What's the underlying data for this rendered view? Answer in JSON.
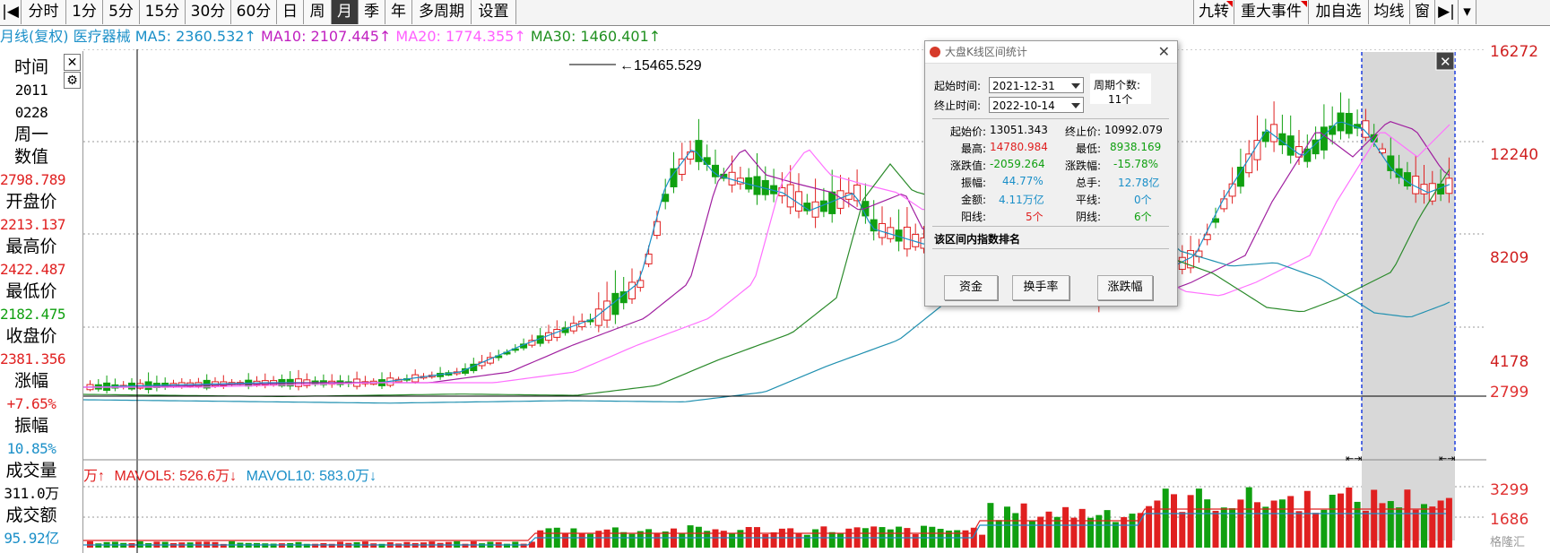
{
  "toolbar": {
    "left": [
      "分时",
      "1分",
      "5分",
      "15分",
      "30分",
      "60分",
      "日",
      "周",
      "月",
      "季",
      "年",
      "多周期",
      "设置"
    ],
    "active": "月",
    "right": [
      "九转",
      "重大事件",
      "加自选",
      "均线",
      "窗"
    ]
  },
  "infobar": {
    "period": "月线(复权)",
    "name": "医疗器械",
    "ma5": "MA5: 2360.532↑",
    "ma10": "MA10: 2107.445↑",
    "ma20": "MA20: 1774.355↑",
    "ma30": "MA30: 1460.401↑"
  },
  "left_panel": {
    "time_label": "时间",
    "year": "2011",
    "date": "0228",
    "weekday": "周一",
    "value_label": "数值",
    "value": "2798.789",
    "open_label": "开盘价",
    "open": "2213.137",
    "high_label": "最高价",
    "high": "2422.487",
    "low_label": "最低价",
    "low": "2182.475",
    "close_label": "收盘价",
    "close": "2381.356",
    "change_label": "涨幅",
    "change": "+7.65%",
    "amp_label": "振幅",
    "amp": "10.85%",
    "vol_label": "成交量",
    "vol": "311.0万",
    "amt_label": "成交额",
    "amt": "95.92亿"
  },
  "price_axis": [
    "16272",
    "12240",
    "8209",
    "4178",
    "2799"
  ],
  "volume_axis": [
    "3299",
    "1686"
  ],
  "peak_label": "15465.529",
  "volume_bar": {
    "unit": "万↑",
    "mavol5": "MAVOL5: 526.6万↓",
    "mavol10": "MAVOL10: 583.0万↓"
  },
  "dialog": {
    "title": "大盘K线区间统计",
    "start_time_label": "起始时间:",
    "start_time": "2021-12-31",
    "end_time_label": "终止时间:",
    "end_time": "2022-10-14",
    "period_count_label": "周期个数:",
    "period_count": "11个",
    "stats": [
      {
        "l1": "起始价:",
        "v1": "13051.343",
        "l2": "终止价:",
        "v2": "10992.079"
      },
      {
        "l1": "最高:",
        "v1": "14780.984",
        "l2": "最低:",
        "v2": "8938.169"
      },
      {
        "l1": "涨跌值:",
        "v1": "-2059.264",
        "l2": "涨跌幅:",
        "v2": "-15.78%"
      },
      {
        "l1": "振幅:",
        "v1": "44.77%",
        "l2": "总手:",
        "v2": "12.78亿"
      },
      {
        "l1": "金额:",
        "v1": "4.11万亿",
        "l2": "平线:",
        "v2": "0个"
      },
      {
        "l1": "阳线:",
        "v1": "5个",
        "l2": "阴线:",
        "v2": "6个"
      }
    ],
    "rank_label": "该区间内指数排名",
    "buttons": [
      "资金",
      "换手率",
      "涨跌幅"
    ]
  },
  "watermark": "格隆汇",
  "colors": {
    "up": "#e02020",
    "down": "#10a010",
    "ma5": "#1a8fc8",
    "ma10": "#a020a0",
    "ma20": "#ff70ff",
    "ma30": "#2a8a2a",
    "ma60": "#2090b0"
  }
}
